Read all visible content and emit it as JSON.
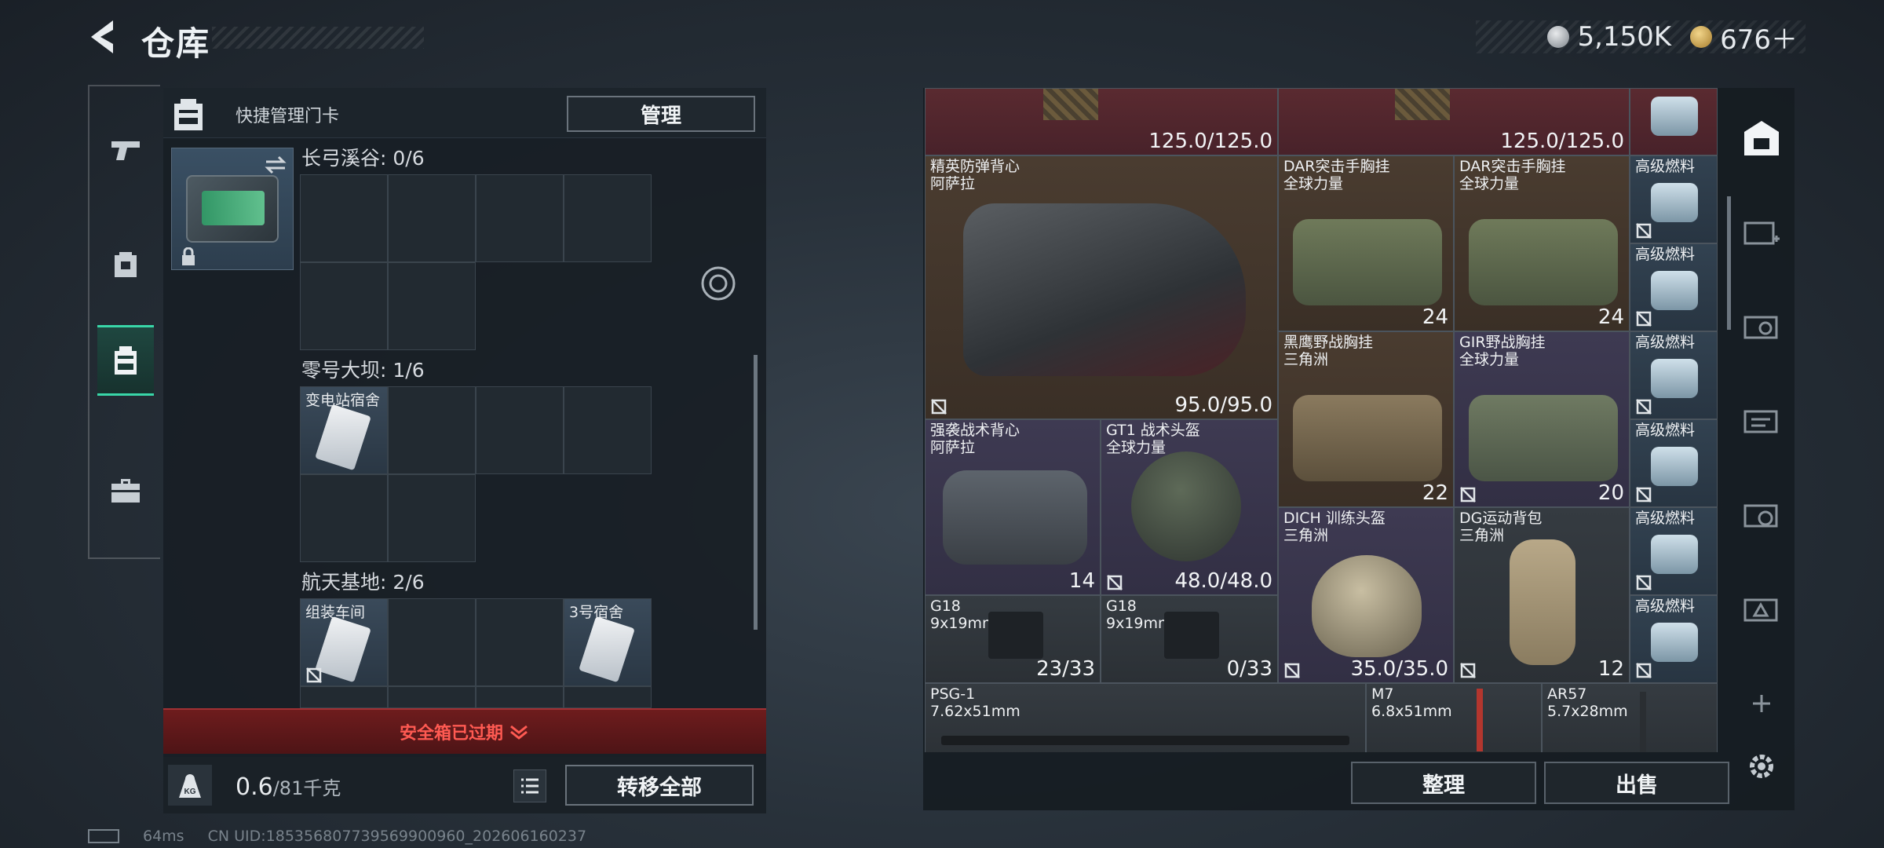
{
  "header": {
    "title": "仓库",
    "back_icon": "back-arrow-icon"
  },
  "currency": {
    "silver": "5,150K",
    "gold": "676＋"
  },
  "left_nav": [
    "pistol-icon",
    "backpack-icon",
    "keycard-holder-icon",
    "toolbox-icon"
  ],
  "left_panel": {
    "header_label": "快捷管理门卡",
    "manage_label": "管理",
    "groups": [
      {
        "label": "长弓溪谷: 0/6"
      },
      {
        "label": "零号大坝: 1/6",
        "cards": [
          {
            "name": "变电站宿舍"
          }
        ]
      },
      {
        "label": "航天基地: 2/6",
        "cards": [
          {
            "name": "组装车间"
          },
          {
            "name": "3号宿舍"
          }
        ]
      }
    ],
    "warning": "安全箱已过期",
    "weight_value": "0.6",
    "weight_total": "/81千克",
    "transfer_label": "转移全部"
  },
  "status": {
    "ping": "64ms",
    "uid": "CN UID:185356807739569900960_202606160237"
  },
  "inventory": {
    "items": [
      {
        "id": "top-a",
        "value": "125.0/125.0"
      },
      {
        "id": "top-b",
        "value": "125.0/125.0"
      },
      {
        "id": "vest-elite",
        "name": "精英防弹背心\n阿萨拉",
        "value": "95.0/95.0"
      },
      {
        "id": "rig-dar1",
        "name": "DAR突击手胸挂\n全球力量",
        "value": "24"
      },
      {
        "id": "rig-dar2",
        "name": "DAR突击手胸挂\n全球力量",
        "value": "24"
      },
      {
        "id": "rig-blackhawk",
        "name": "黑鹰野战胸挂\n三角洲",
        "value": "22"
      },
      {
        "id": "rig-gir",
        "name": "GIR野战胸挂\n全球力量",
        "value": "20"
      },
      {
        "id": "vest-assault",
        "name": "强袭战术背心\n阿萨拉",
        "value": "14"
      },
      {
        "id": "helmet-gt1",
        "name": "GT1 战术头盔\n全球力量",
        "value": "48.0/48.0"
      },
      {
        "id": "helmet-dich",
        "name": "DICH 训练头盔\n三角洲",
        "value": "35.0/35.0"
      },
      {
        "id": "backpack-dg",
        "name": "DG运动背包\n三角洲",
        "value": "12"
      },
      {
        "id": "g18a",
        "name": "G18\n9x19mm",
        "value": "23/33"
      },
      {
        "id": "g18b",
        "name": "G18\n9x19mm",
        "value": "0/33"
      },
      {
        "id": "psg1",
        "name": "PSG-1\n7.62x51mm"
      },
      {
        "id": "m7",
        "name": "M7\n6.8x51mm"
      },
      {
        "id": "ar57",
        "name": "AR57\n5.7x28mm"
      }
    ],
    "fuel_label": "高级燃料",
    "sort_label": "整理",
    "sell_label": "出售"
  },
  "right_rail": [
    "stash-icon",
    "weapon-case-icon",
    "gear-case-icon",
    "keycard-case-icon",
    "med-case-icon",
    "safe-case-icon",
    "add-icon",
    "settings-icon"
  ]
}
